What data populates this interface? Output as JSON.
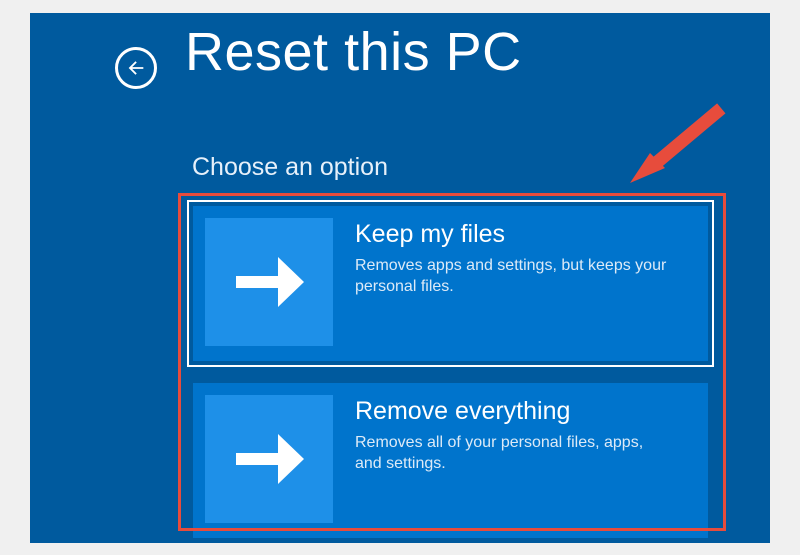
{
  "header": {
    "title": "Reset this PC"
  },
  "subtitle": "Choose an option",
  "options": [
    {
      "title": "Keep my files",
      "description": "Removes apps and settings, but keeps your personal files.",
      "selected": true
    },
    {
      "title": "Remove everything",
      "description": "Removes all of your personal files, apps, and settings.",
      "selected": false
    }
  ],
  "colors": {
    "background": "#005A9E",
    "tile": "#0074CC",
    "tile_icon": "#1E90E8",
    "annotation": "#E74C3C"
  }
}
